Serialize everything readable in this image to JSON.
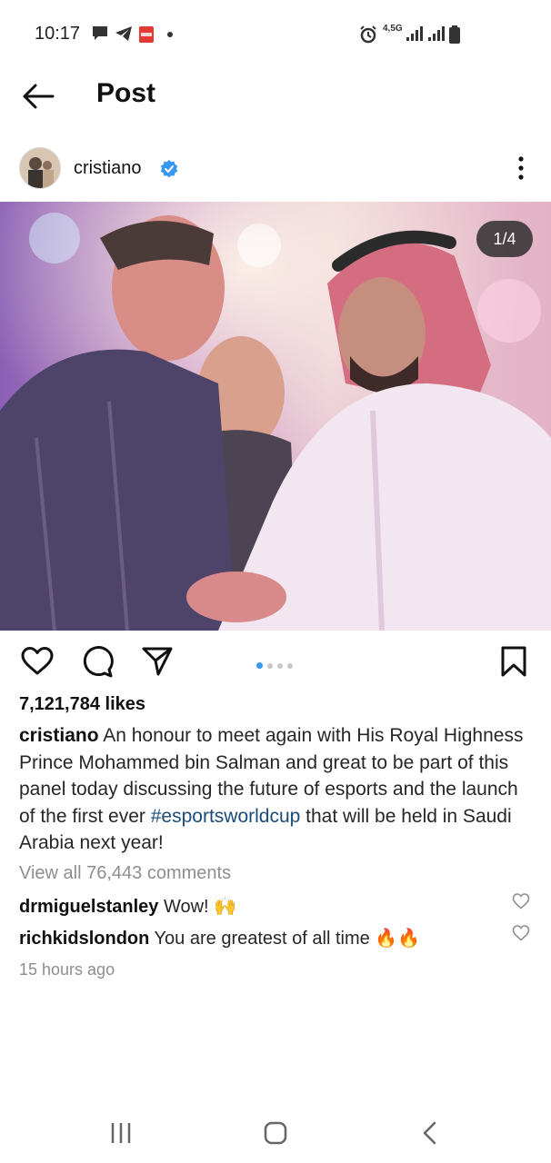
{
  "status_bar": {
    "time": "10:17",
    "network": "4,5G"
  },
  "header": {
    "title": "Post",
    "back_icon": "arrow-left-icon"
  },
  "post": {
    "username": "cristiano",
    "image_counter": "1/4",
    "likes": "7,121,784 likes",
    "caption": {
      "username": "cristiano",
      "text_before": " An honour to meet again with His Royal Highness Prince Mohammed bin Salman and great to be part of this panel today discussing the future of esports and the launch of the first ever ",
      "hashtag": "#esportsworldcup",
      "text_after": " that will be held in Saudi Arabia next year!"
    },
    "view_all_comments": "View all 76,443 comments",
    "comments": [
      {
        "username": "drmiguelstanley",
        "text": "Wow! 🙌"
      },
      {
        "username": "richkidslondon",
        "text": "You are greatest of all time 🔥🔥"
      }
    ],
    "timestamp": "15 hours ago",
    "carousel": {
      "count": 4,
      "active": 1
    }
  },
  "colors": {
    "verified": "#3897f0",
    "hashtag": "#1c4b7a",
    "muted": "#8e8e8e"
  }
}
